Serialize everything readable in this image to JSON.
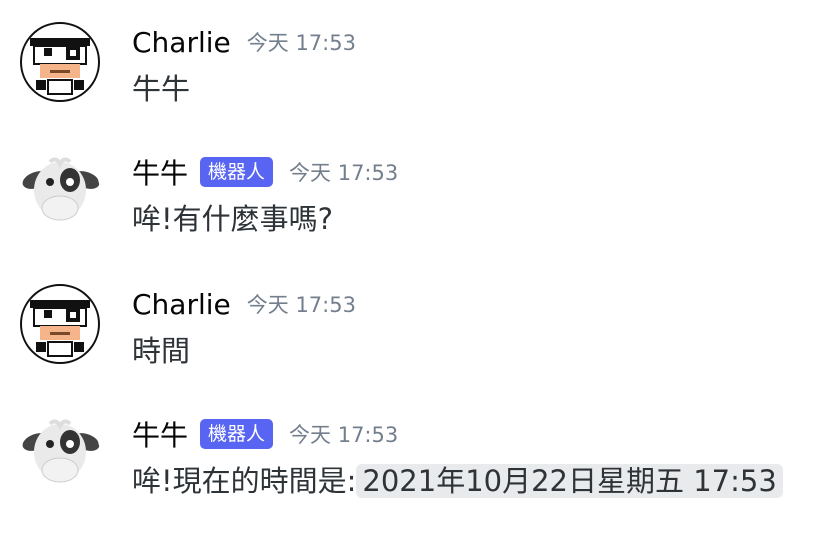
{
  "messages": [
    {
      "author": "Charlie",
      "badge": "",
      "timestamp": "今天 17:53",
      "text": "牛牛",
      "code": ""
    },
    {
      "author": "牛牛",
      "badge": "機器人",
      "timestamp": "今天 17:53",
      "text": "哞!有什麼事嗎?",
      "code": ""
    },
    {
      "author": "Charlie",
      "badge": "",
      "timestamp": "今天 17:53",
      "text": "時間",
      "code": ""
    },
    {
      "author": "牛牛",
      "badge": "機器人",
      "timestamp": "今天 17:53",
      "text": "哞!現在的時間是:",
      "code": "2021年10月22日星期五 17:53"
    }
  ],
  "colors": {
    "bot_badge": "#5865f2",
    "timestamp": "#747f8d",
    "code_bg": "#e9eaec"
  },
  "icons": {
    "user_avatar": "pixel-cow-avatar-icon",
    "bot_avatar": "cow-plush-avatar-icon"
  }
}
